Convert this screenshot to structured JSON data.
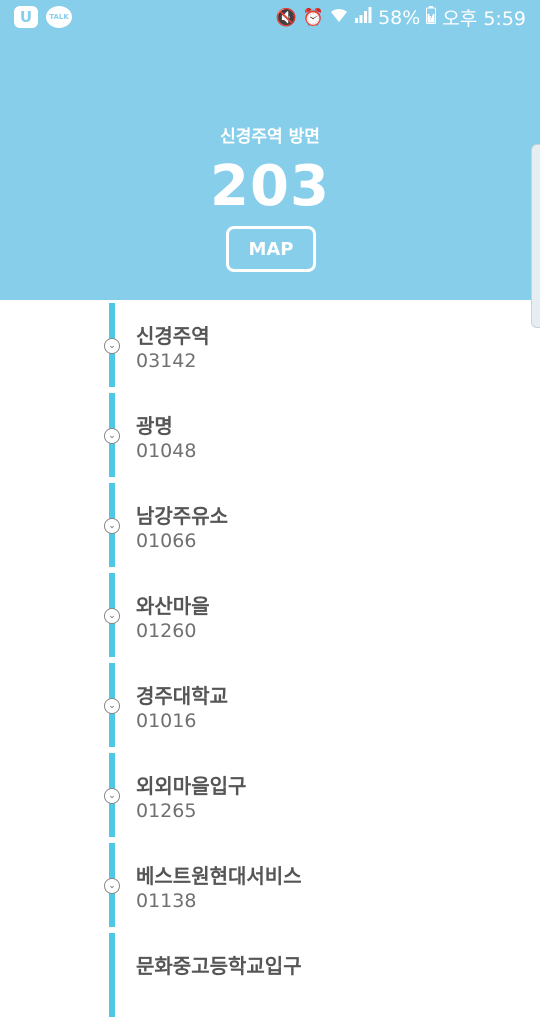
{
  "status_bar": {
    "left_icons": [
      "u-plus-icon",
      "kakaotalk-icon"
    ],
    "talk_label": "TALK",
    "u_label": "U",
    "battery": "58%",
    "time": "오후 5:59",
    "right_icons": [
      "mute-icon",
      "alarm-icon",
      "wifi-icon",
      "signal-icon",
      "battery-charging-icon"
    ]
  },
  "header": {
    "direction": "신경주역 방면",
    "route_number": "203",
    "map_button_label": "MAP",
    "background_color": "#87ceeb"
  },
  "stops": [
    {
      "name": "신경주역",
      "id": "03142"
    },
    {
      "name": "광명",
      "id": "01048"
    },
    {
      "name": "남강주유소",
      "id": "01066"
    },
    {
      "name": "와산마을",
      "id": "01260"
    },
    {
      "name": "경주대학교",
      "id": "01016"
    },
    {
      "name": "외외마을입구",
      "id": "01265"
    },
    {
      "name": "베스트원현대서비스",
      "id": "01138"
    },
    {
      "name": "문화중고등학교입구",
      "id": ""
    }
  ],
  "colors": {
    "route_line": "#4fc8e6",
    "stop_name": "#555555",
    "stop_id": "#707070"
  }
}
